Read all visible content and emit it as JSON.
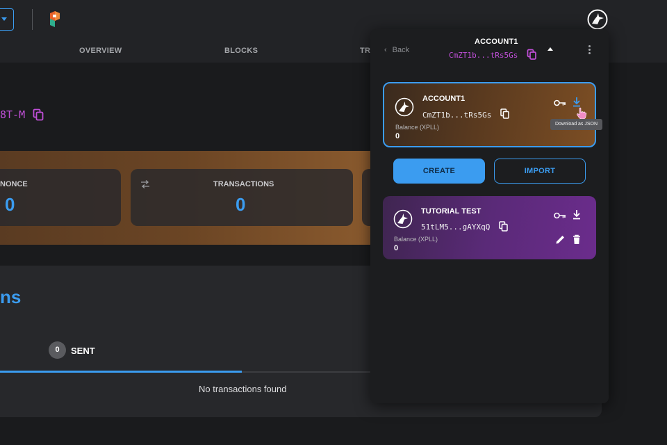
{
  "nav": {
    "items": [
      "OVERVIEW",
      "BLOCKS",
      "TR"
    ]
  },
  "page": {
    "address_fragment": "8T-M",
    "stats": [
      {
        "label": "NONCE",
        "value": "0"
      },
      {
        "label": "TRANSACTIONS",
        "value": "0"
      }
    ],
    "transactions_title_fragment": "ns",
    "sent_count": "0",
    "sent_label": "SENT",
    "empty_message": "No transactions found"
  },
  "popup": {
    "back_label": "Back",
    "title": "ACCOUNT1",
    "address": "CmZT1b...tRs5Gs",
    "accounts": [
      {
        "name": "ACCOUNT1",
        "address": "CmZT1b...tRs5Gs",
        "balance_label": "Balance (XPLL)",
        "balance": "0"
      },
      {
        "name": "TUTORIAL TEST",
        "address": "51tLM5...gAYXqQ",
        "balance_label": "Balance (XPLL)",
        "balance": "0"
      }
    ],
    "tooltip": "Download as JSON",
    "create_label": "CREATE",
    "import_label": "IMPORT"
  },
  "colors": {
    "accent": "#3b9cf0",
    "address": "#c04fd8",
    "account1_card": "#6b4524",
    "account2_card": "#5a2a78"
  }
}
